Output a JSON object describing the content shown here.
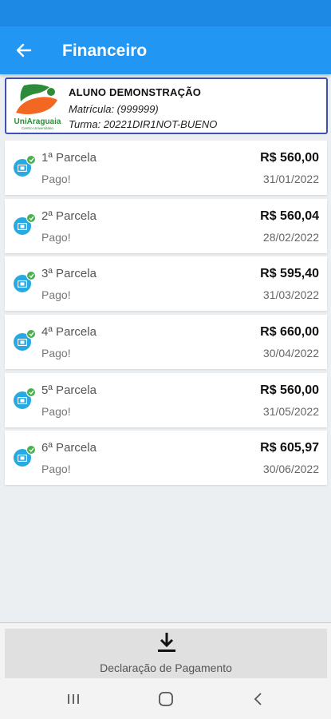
{
  "header": {
    "title": "Financeiro"
  },
  "student": {
    "logo_text": "UniAraguaia",
    "logo_subtext": "Centro Universitário",
    "name": "ALUNO DEMONSTRAÇÃO",
    "matricula": "Matrícula: (999999)",
    "turma": "Turma: 20221DIR1NOT-BUENO"
  },
  "installments": [
    {
      "label": "1ª Parcela",
      "status": "Pago!",
      "amount": "R$ 560,00",
      "date": "31/01/2022"
    },
    {
      "label": "2ª Parcela",
      "status": "Pago!",
      "amount": "R$ 560,04",
      "date": "28/02/2022"
    },
    {
      "label": "3ª Parcela",
      "status": "Pago!",
      "amount": "R$ 595,40",
      "date": "31/03/2022"
    },
    {
      "label": "4ª Parcela",
      "status": "Pago!",
      "amount": "R$ 660,00",
      "date": "30/04/2022"
    },
    {
      "label": "5ª Parcela",
      "status": "Pago!",
      "amount": "R$ 560,00",
      "date": "31/05/2022"
    },
    {
      "label": "6ª Parcela",
      "status": "Pago!",
      "amount": "R$ 605,97",
      "date": "30/06/2022"
    }
  ],
  "footer": {
    "declaration_label": "Declaração de Pagamento"
  },
  "icons": {
    "back": "arrow-left-icon",
    "installment": "money-icon",
    "paid": "check-badge-icon",
    "download": "download-icon",
    "nav_recents": "recents-icon",
    "nav_home": "home-icon",
    "nav_back": "chevron-left-icon"
  },
  "colors": {
    "app_bar": "#2196f3",
    "status_bar": "#1e88e5",
    "card_border": "#3f51b5",
    "installment_icon": "#29a9e1",
    "paid_badge": "#4caf50",
    "logo_green": "#2e8b3a",
    "logo_orange": "#f26722"
  }
}
